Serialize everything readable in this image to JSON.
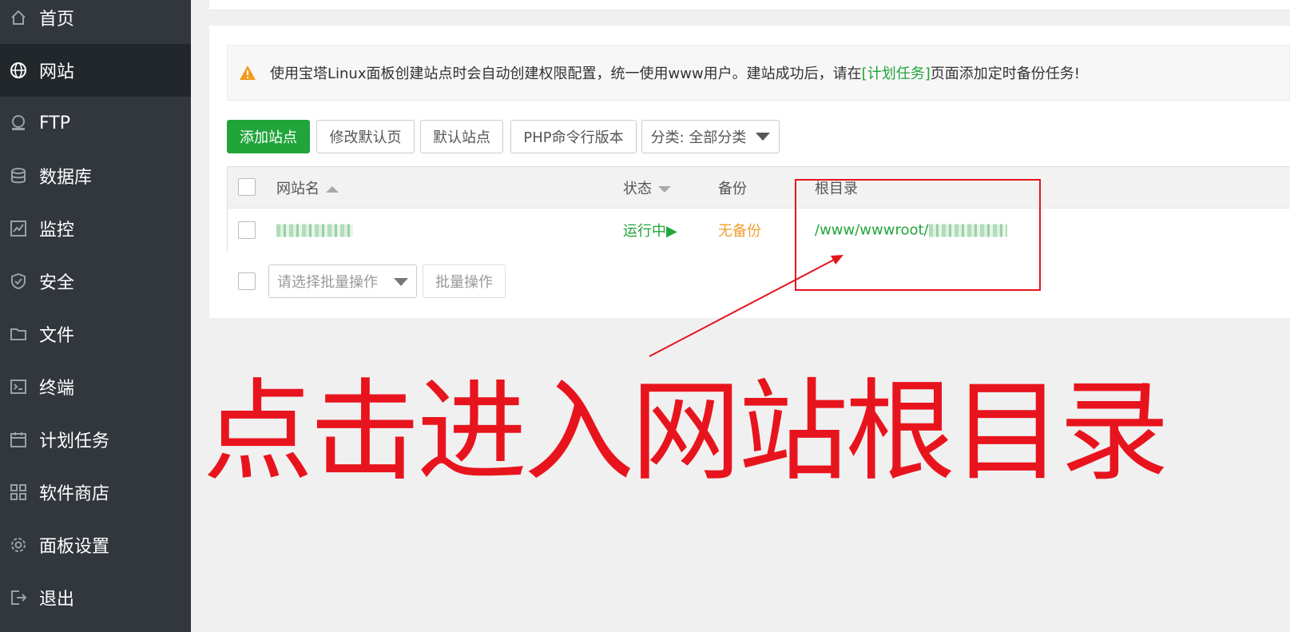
{
  "sidebar": {
    "items": [
      {
        "label": "首页",
        "icon": "home-icon"
      },
      {
        "label": "网站",
        "icon": "globe-icon",
        "active": true
      },
      {
        "label": "FTP",
        "icon": "ftp-icon"
      },
      {
        "label": "数据库",
        "icon": "database-icon"
      },
      {
        "label": "监控",
        "icon": "monitor-icon"
      },
      {
        "label": "安全",
        "icon": "shield-icon"
      },
      {
        "label": "文件",
        "icon": "folder-icon"
      },
      {
        "label": "终端",
        "icon": "terminal-icon"
      },
      {
        "label": "计划任务",
        "icon": "calendar-icon"
      },
      {
        "label": "软件商店",
        "icon": "apps-icon"
      },
      {
        "label": "面板设置",
        "icon": "gear-icon"
      },
      {
        "label": "退出",
        "icon": "logout-icon"
      }
    ]
  },
  "notice": {
    "before": "使用宝塔Linux面板创建站点时会自动创建权限配置，统一使用www用户。建站成功后，请在",
    "link": "[计划任务]",
    "after": "页面添加定时备份任务!"
  },
  "toolbar": {
    "add_site": "添加站点",
    "edit_default_page": "修改默认页",
    "default_site": "默认站点",
    "php_cli_version": "PHP命令行版本",
    "category_select": "分类: 全部分类"
  },
  "table": {
    "headers": {
      "name": "网站名",
      "status": "状态",
      "backup": "备份",
      "root": "根目录"
    },
    "rows": [
      {
        "status": "运行中▶",
        "backup": "无备份",
        "root_prefix": "/www/wwwroot/"
      }
    ]
  },
  "batch": {
    "placeholder": "请选择批量操作",
    "button": "批量操作"
  },
  "annotation": {
    "text": "点击进入网站根目录"
  },
  "colors": {
    "sidebar_bg": "#32373d",
    "accent_green": "#20a53a",
    "backup_orange": "#f0a030",
    "annotation_red": "#e8141d"
  }
}
